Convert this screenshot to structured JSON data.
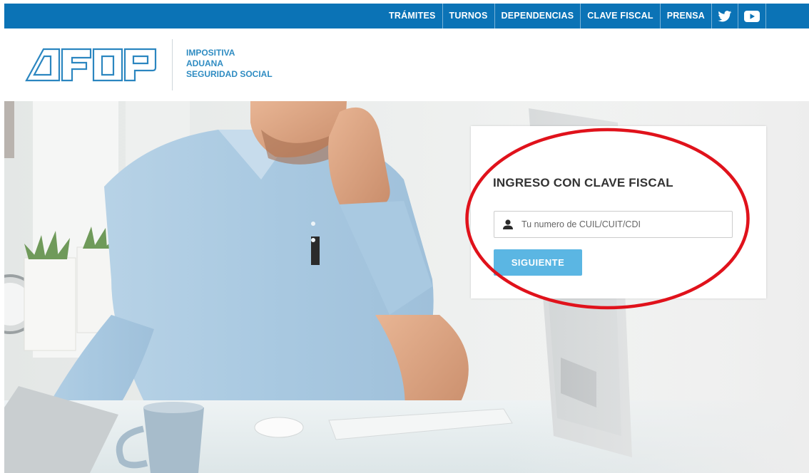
{
  "nav": {
    "items": [
      "TRÁMITES",
      "TURNOS",
      "DEPENDENCIAS",
      "CLAVE FISCAL",
      "PRENSA"
    ],
    "social": [
      "twitter-icon",
      "youtube-icon"
    ]
  },
  "brand": {
    "logo_text": "AFIP",
    "tagline": [
      "IMPOSITIVA",
      "ADUANA",
      "SEGURIDAD SOCIAL"
    ]
  },
  "login": {
    "title": "INGRESO CON CLAVE FISCAL",
    "input_placeholder": "Tu numero de CUIL/CUIT/CDI",
    "input_value": "",
    "button_label": "SIGUIENTE",
    "input_icon": "user-icon"
  },
  "colors": {
    "topbar": "#0b73b6",
    "brand_blue": "#2f8cc2",
    "button": "#5bb6e3",
    "annotation": "#e0121b"
  }
}
